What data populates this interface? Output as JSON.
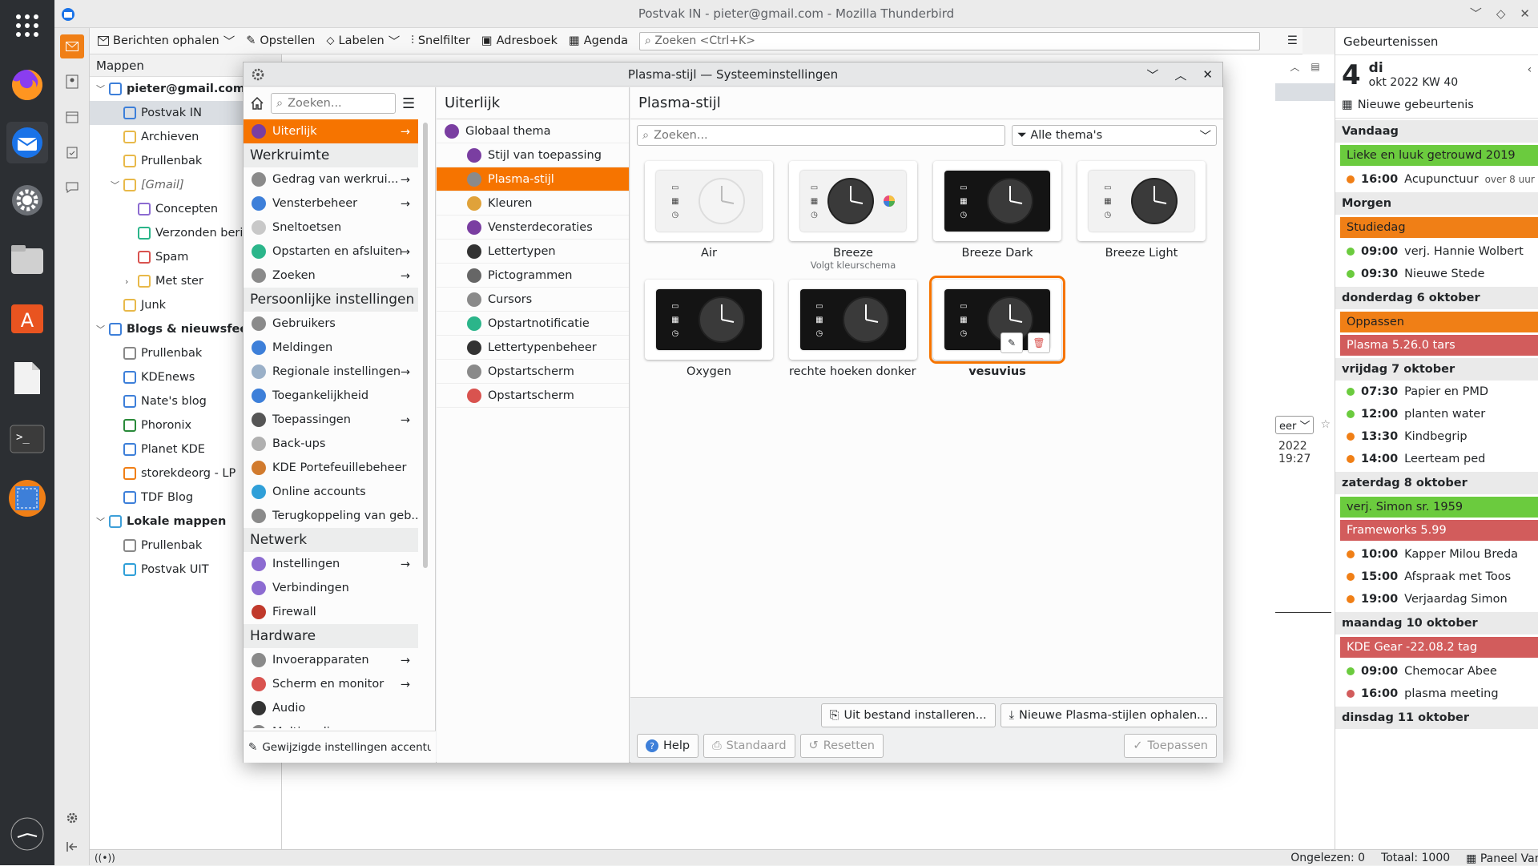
{
  "window": {
    "title": "Postvak IN - pieter@gmail.com - Mozilla Thunderbird"
  },
  "toolbar": {
    "get_messages": "Berichten ophalen",
    "compose": "Opstellen",
    "tag": "Labelen",
    "quick_filter": "Snelfilter",
    "address_book": "Adresboek",
    "calendar": "Agenda",
    "search_placeholder": "Zoeken <Ctrl+K>"
  },
  "folders": {
    "header": "Mappen",
    "items": [
      {
        "label": "pieter@gmail.com",
        "indent": 0,
        "bold": true,
        "icon": "mail-account-icon"
      },
      {
        "label": "Postvak IN",
        "indent": 1,
        "selected": true,
        "icon": "inbox-icon"
      },
      {
        "label": "Archieven",
        "indent": 1,
        "icon": "folder-icon"
      },
      {
        "label": "Prullenbak",
        "indent": 1,
        "icon": "folder-icon"
      },
      {
        "label": "[Gmail]",
        "indent": 1,
        "italic": true,
        "icon": "folder-icon"
      },
      {
        "label": "Concepten",
        "indent": 2,
        "icon": "drafts-icon"
      },
      {
        "label": "Verzonden bericht",
        "indent": 2,
        "icon": "sent-icon"
      },
      {
        "label": "Spam",
        "indent": 2,
        "icon": "spam-icon"
      },
      {
        "label": "Met ster",
        "indent": 2,
        "icon": "folder-icon"
      },
      {
        "label": "Junk",
        "indent": 1,
        "icon": "folder-icon"
      },
      {
        "label": "Blogs & nieuwsfeeds",
        "indent": 0,
        "bold": true,
        "icon": "rss-icon"
      },
      {
        "label": "Prullenbak",
        "indent": 1,
        "icon": "trash-icon"
      },
      {
        "label": "KDEnews",
        "indent": 1,
        "icon": "feed-icon"
      },
      {
        "label": "Nate's blog",
        "indent": 1,
        "icon": "feed-icon"
      },
      {
        "label": "Phoronix",
        "indent": 1,
        "icon": "feed-icon"
      },
      {
        "label": "Planet KDE",
        "indent": 1,
        "icon": "feed-icon"
      },
      {
        "label": "storekdeorg -  LP",
        "indent": 1,
        "icon": "feed-icon"
      },
      {
        "label": "TDF Blog",
        "indent": 1,
        "icon": "feed-icon"
      },
      {
        "label": "Lokale mappen",
        "indent": 0,
        "bold": true,
        "icon": "local-folder-icon"
      },
      {
        "label": "Prullenbak",
        "indent": 1,
        "icon": "trash-icon"
      },
      {
        "label": "Postvak UIT",
        "indent": 1,
        "icon": "outbox-icon"
      }
    ]
  },
  "background_msg": {
    "date": "2022 19:27",
    "btn": "eer"
  },
  "dialog": {
    "title": "Plasma-stijl — Systeeminstellingen",
    "search_placeholder": "Zoeken...",
    "col1": [
      {
        "type": "item",
        "label": "Uiterlijk",
        "selected": true,
        "arrow": true,
        "color": "#7a3ea1"
      },
      {
        "type": "cat",
        "label": "Werkruimte"
      },
      {
        "type": "item",
        "label": "Gedrag van werkrui...",
        "arrow": true,
        "color": "#8a8a8a"
      },
      {
        "type": "item",
        "label": "Vensterbeheer",
        "arrow": true,
        "color": "#3d7fd9"
      },
      {
        "type": "item",
        "label": "Sneltoetsen",
        "color": "#c8c8c8"
      },
      {
        "type": "item",
        "label": "Opstarten en afsluiten",
        "arrow": true,
        "color": "#2bb58a"
      },
      {
        "type": "item",
        "label": "Zoeken",
        "arrow": true,
        "color": "#8a8a8a"
      },
      {
        "type": "cat",
        "label": "Persoonlijke instellingen"
      },
      {
        "type": "item",
        "label": "Gebruikers",
        "color": "#8a8a8a"
      },
      {
        "type": "item",
        "label": "Meldingen",
        "color": "#3d7fd9"
      },
      {
        "type": "item",
        "label": "Regionale instellingen",
        "arrow": true,
        "color": "#9ab0c8"
      },
      {
        "type": "item",
        "label": "Toegankelijkheid",
        "color": "#3d7fd9"
      },
      {
        "type": "item",
        "label": "Toepassingen",
        "arrow": true,
        "color": "#555555"
      },
      {
        "type": "item",
        "label": "Back-ups",
        "color": "#b0b0b0"
      },
      {
        "type": "item",
        "label": "KDE Portefeuillebeheer",
        "color": "#d17b2e"
      },
      {
        "type": "item",
        "label": "Online accounts",
        "color": "#2f9fd8"
      },
      {
        "type": "item",
        "label": "Terugkoppeling van geb...",
        "color": "#8a8a8a"
      },
      {
        "type": "cat",
        "label": "Netwerk"
      },
      {
        "type": "item",
        "label": "Instellingen",
        "arrow": true,
        "color": "#8c6bd1"
      },
      {
        "type": "item",
        "label": "Verbindingen",
        "color": "#8c6bd1"
      },
      {
        "type": "item",
        "label": "Firewall",
        "color": "#c0392b"
      },
      {
        "type": "cat",
        "label": "Hardware"
      },
      {
        "type": "item",
        "label": "Invoerapparaten",
        "arrow": true,
        "color": "#8a8a8a"
      },
      {
        "type": "item",
        "label": "Scherm en monitor",
        "arrow": true,
        "color": "#d9534f"
      },
      {
        "type": "item",
        "label": "Audio",
        "color": "#333333"
      },
      {
        "type": "item",
        "label": "Multimedia",
        "color": "#888888"
      }
    ],
    "col1_footer": "Gewijzigde instellingen accentuere",
    "col2_title": "Uiterlijk",
    "col2": [
      {
        "label": "Globaal thema",
        "color": "#7a3ea1",
        "indent": false
      },
      {
        "label": "Stijl van toepassing",
        "color": "#7a3ea1",
        "indent": true
      },
      {
        "label": "Plasma-stijl",
        "color": "#8a8a8a",
        "indent": true,
        "selected": true
      },
      {
        "label": "Kleuren",
        "color": "#e0a23a",
        "indent": true
      },
      {
        "label": "Vensterdecoraties",
        "color": "#7a3ea1",
        "indent": true
      },
      {
        "label": "Lettertypen",
        "color": "#333333",
        "indent": true
      },
      {
        "label": "Pictogrammen",
        "color": "#666666",
        "indent": true
      },
      {
        "label": "Cursors",
        "color": "#8a8a8a",
        "indent": true
      },
      {
        "label": "Opstartnotificatie",
        "color": "#2bb58a",
        "indent": true
      },
      {
        "label": "Lettertypenbeheer",
        "color": "#333333",
        "indent": true
      },
      {
        "label": "Opstartscherm",
        "color": "#8a8a8a",
        "indent": true
      },
      {
        "label": "Opstartscherm",
        "color": "#d9534f",
        "indent": true
      }
    ],
    "col3_title": "Plasma-stijl",
    "filter": "Alle thema's",
    "themes": [
      {
        "name": "Air",
        "sub": "",
        "dark": false,
        "light_clock": true
      },
      {
        "name": "Breeze",
        "sub": "Volgt kleurschema",
        "dark": false,
        "light_clock": false,
        "wheel": true
      },
      {
        "name": "Breeze Dark",
        "sub": "",
        "dark": true,
        "light_clock": false
      },
      {
        "name": "Breeze Light",
        "sub": "",
        "dark": false,
        "light_clock": false
      },
      {
        "name": "Oxygen",
        "sub": "",
        "dark": true,
        "light_clock": false,
        "oxygen": true
      },
      {
        "name": "rechte hoeken donker ...",
        "sub": "",
        "dark": true,
        "light_clock": false
      },
      {
        "name": "vesuvius",
        "sub": "",
        "dark": true,
        "light_clock": false,
        "selected": true
      }
    ],
    "buttons": {
      "install": "Uit bestand installeren...",
      "get_new": "Nieuwe Plasma-stijlen ophalen...",
      "help": "Help",
      "defaults": "Standaard",
      "reset": "Resetten",
      "apply": "Toepassen"
    }
  },
  "events": {
    "header": "Gebeurtenissen",
    "day_num": "4",
    "day_name": "di",
    "month_week": "okt 2022  KW 40",
    "new_event": "Nieuwe gebeurtenis",
    "groups": [
      {
        "title": "Vandaag",
        "rows": [
          {
            "kind": "bar",
            "text": "Lieke en luuk getrouwd 2019",
            "color": "#6bcb3e"
          },
          {
            "kind": "item",
            "time": "16:00",
            "text": "Acupunctuur",
            "extra": "over 8 uur",
            "color": "#f07f16"
          }
        ]
      },
      {
        "title": "Morgen",
        "rows": [
          {
            "kind": "bar",
            "text": "Studiedag",
            "color": "#f07f16"
          },
          {
            "kind": "item",
            "time": "09:00",
            "text": "verj. Hannie Wolbert",
            "color": "#6bcb3e"
          },
          {
            "kind": "item",
            "time": "09:30",
            "text": "Nieuwe Stede",
            "color": "#6bcb3e"
          }
        ]
      },
      {
        "title": "donderdag 6 oktober",
        "rows": [
          {
            "kind": "bar",
            "text": "Oppassen",
            "color": "#f07f16"
          },
          {
            "kind": "bar",
            "text": "Plasma 5.26.0 tars",
            "color": "#d25c5c",
            "light": true
          }
        ]
      },
      {
        "title": "vrijdag 7 oktober",
        "rows": [
          {
            "kind": "item",
            "time": "07:30",
            "text": "Papier en PMD",
            "color": "#6bcb3e"
          },
          {
            "kind": "item",
            "time": "12:00",
            "text": "planten water",
            "color": "#6bcb3e"
          },
          {
            "kind": "item",
            "time": "13:30",
            "text": "Kindbegrip",
            "color": "#f07f16"
          },
          {
            "kind": "item",
            "time": "14:00",
            "text": "Leerteam ped",
            "color": "#f07f16"
          }
        ]
      },
      {
        "title": "zaterdag 8 oktober",
        "rows": [
          {
            "kind": "bar",
            "text": "verj. Simon sr. 1959",
            "color": "#6bcb3e"
          },
          {
            "kind": "bar",
            "text": "Frameworks 5.99",
            "color": "#d25c5c",
            "light": true
          },
          {
            "kind": "item",
            "time": "10:00",
            "text": "Kapper Milou Breda",
            "color": "#f07f16"
          },
          {
            "kind": "item",
            "time": "15:00",
            "text": "Afspraak met Toos",
            "color": "#f07f16"
          },
          {
            "kind": "item",
            "time": "19:00",
            "text": "Verjaardag Simon",
            "color": "#f07f16"
          }
        ]
      },
      {
        "title": "maandag 10 oktober",
        "rows": [
          {
            "kind": "bar",
            "text": "KDE Gear -22.08.2 tag",
            "color": "#d25c5c",
            "light": true
          },
          {
            "kind": "item",
            "time": "09:00",
            "text": "Chemocar Abee",
            "color": "#6bcb3e"
          },
          {
            "kind": "item",
            "time": "16:00",
            "text": "plasma meeting",
            "color": "#d25c5c"
          }
        ]
      },
      {
        "title": "dinsdag 11 oktober",
        "rows": []
      }
    ]
  },
  "statusbar": {
    "unread": "Ongelezen: 0",
    "total": "Totaal: 1000",
    "today_pane": "Paneel Vandaag"
  }
}
